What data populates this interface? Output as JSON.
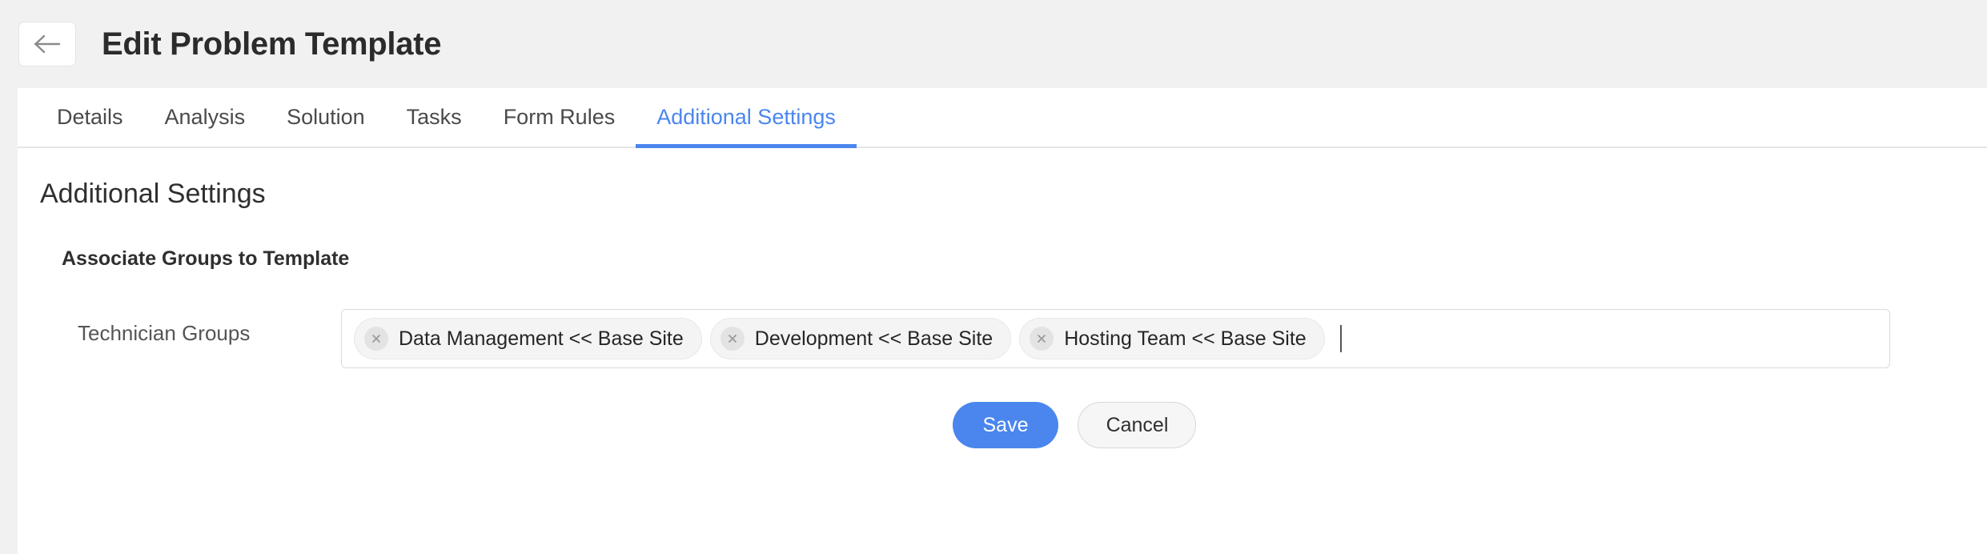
{
  "header": {
    "back_icon": "arrow-left-icon",
    "title": "Edit Problem Template"
  },
  "tabs": [
    {
      "label": "Details",
      "active": false
    },
    {
      "label": "Analysis",
      "active": false
    },
    {
      "label": "Solution",
      "active": false
    },
    {
      "label": "Tasks",
      "active": false
    },
    {
      "label": "Form Rules",
      "active": false
    },
    {
      "label": "Additional Settings",
      "active": true
    }
  ],
  "main": {
    "section_title": "Additional Settings",
    "subsection_title": "Associate Groups to Template",
    "field": {
      "label": "Technician Groups",
      "placeholder": "",
      "chips": [
        {
          "label": "Data Management << Base Site",
          "remove_icon": "close-circle-icon"
        },
        {
          "label": "Development << Base Site",
          "remove_icon": "close-circle-icon"
        },
        {
          "label": "Hosting Team << Base Site",
          "remove_icon": "close-circle-icon"
        }
      ]
    },
    "actions": {
      "save_label": "Save",
      "cancel_label": "Cancel"
    }
  },
  "colors": {
    "accent": "#4a86ee",
    "page_background": "#f1f1f1",
    "panel_background": "#ffffff",
    "title_text": "#2b2b2b",
    "label_text": "#555555",
    "chip_background": "#f4f4f4"
  }
}
